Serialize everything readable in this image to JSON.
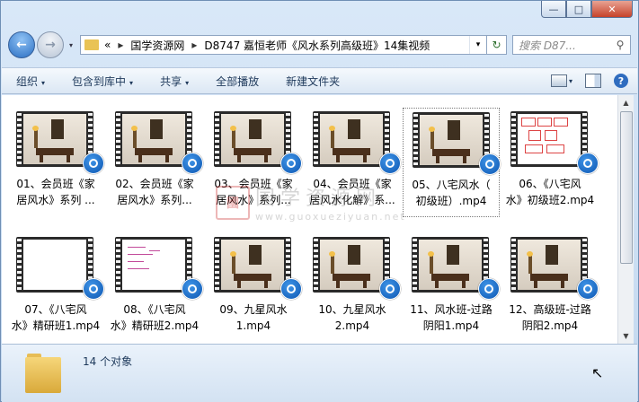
{
  "window": {
    "caption_buttons": [
      "—",
      "□",
      "✕"
    ]
  },
  "nav": {
    "back_glyph": "←",
    "forward_glyph": "→",
    "dropdown_glyph": "▾"
  },
  "address": {
    "overflow": "«",
    "crumbs": [
      "国学资源网",
      "D8747 嘉恒老师《风水系列高级班》14集视频"
    ],
    "separator": "▸",
    "dropdown": "▾",
    "refresh_glyph": "↻"
  },
  "search": {
    "placeholder": "搜索 D87...",
    "icon": "search-icon",
    "icon_glyph": "⚲"
  },
  "toolbar": {
    "items": [
      {
        "label": "组织",
        "arrow": "▾"
      },
      {
        "label": "包含到库中",
        "arrow": "▾"
      },
      {
        "label": "共享",
        "arrow": "▾"
      },
      {
        "label": "全部播放",
        "arrow": ""
      },
      {
        "label": "新建文件夹",
        "arrow": ""
      }
    ],
    "view_arrow": "▾",
    "help": "?"
  },
  "files": [
    {
      "line1": "01、会员班《家",
      "line2": "居风水》系列 ...",
      "thumb": "scene",
      "selected": false
    },
    {
      "line1": "02、会员班《家",
      "line2": "居风水》系列...",
      "thumb": "scene",
      "selected": false
    },
    {
      "line1": "03、会员班《家",
      "line2": "居风水》系列...",
      "thumb": "scene",
      "selected": false
    },
    {
      "line1": "04、会员班《家",
      "line2": "居风水化解》系...",
      "thumb": "scene",
      "selected": false
    },
    {
      "line1": "05、八宅风水（",
      "line2": "初级班）.mp4",
      "thumb": "scene",
      "selected": true
    },
    {
      "line1": "06、《八宅风",
      "line2": "水》初级班2.mp4",
      "thumb": "diagram",
      "selected": false
    },
    {
      "line1": "07、《八宅风",
      "line2": "水》精研班1.mp4",
      "thumb": "white",
      "selected": false
    },
    {
      "line1": "08、《八宅风",
      "line2": "水》精研班2.mp4",
      "thumb": "note",
      "selected": false
    },
    {
      "line1": "09、九星风水",
      "line2": "1.mp4",
      "thumb": "scene",
      "selected": false
    },
    {
      "line1": "10、九星风水",
      "line2": "2.mp4",
      "thumb": "scene",
      "selected": false
    },
    {
      "line1": "11、风水班-过路",
      "line2": "阴阳1.mp4",
      "thumb": "scene",
      "selected": false
    },
    {
      "line1": "12、高级班-过路",
      "line2": "阴阳2.mp4",
      "thumb": "scene",
      "selected": false
    }
  ],
  "watermark": {
    "seal": "國",
    "cn": "国学资源网",
    "en": "www.guoxueziyuan.net"
  },
  "details": {
    "count": "14 个对象"
  },
  "colors": {
    "accent": "#2b6fc2",
    "close": "#c6422a",
    "badge": "#0d56b1"
  }
}
